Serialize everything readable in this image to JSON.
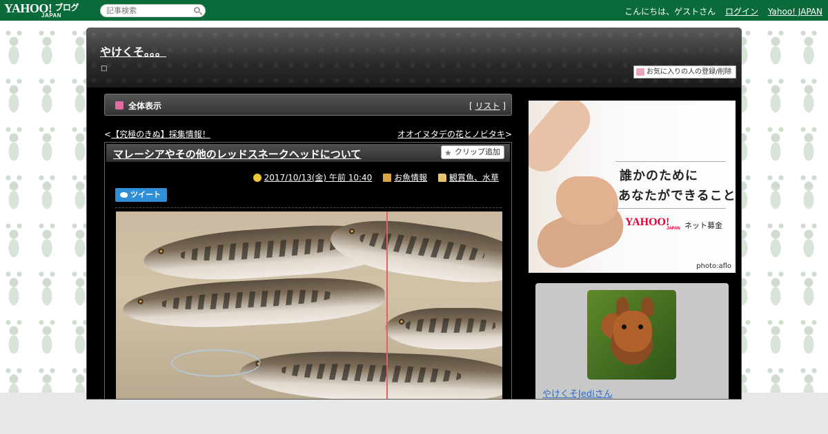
{
  "topbar": {
    "logo_text": "YAHOO!",
    "logo_sub": "JAPAN",
    "logo_blog": "ブログ",
    "search_placeholder": "記事検索",
    "greeting": "こんにちは、ゲストさん",
    "login_label": "ログイン",
    "yahoo_japan_label": "Yahoo! JAPAN"
  },
  "blog": {
    "title": "やけくそ。。。",
    "subtitle": "□",
    "favorite_button": "お気に入りの人の登録/削除"
  },
  "main": {
    "all_view_label": "全体表示",
    "list_bracket_open": "[ ",
    "list_label": "リスト",
    "list_bracket_close": " ]",
    "prev_arrow": "<",
    "prev_link": "【究極のきぬ】採集情報！",
    "next_link": "オオイヌタデの花とノビタキ",
    "next_arrow": ">"
  },
  "article": {
    "title": "マレーシアやその他のレッドスネークヘッドについて",
    "clip_button": "クリップ追加",
    "date": "2017/10/13(金) 午前 10:40",
    "category1": "お魚情報",
    "category2": "観賞魚、水草",
    "tweet_label": "ツイート"
  },
  "sidebar": {
    "ad": {
      "line1": "誰かのために",
      "line2": "あなたができること",
      "brand": "YAHOO!",
      "brand_sub": "JAPAN",
      "service": "ネット募金",
      "credit": "photo:aflo"
    },
    "profile_name": "やけくそJediさん"
  },
  "colors": {
    "topbar_bg": "#0a6a3a",
    "frame_bg": "#000000",
    "link_blue": "#2a6fd0",
    "accent_pink": "#e36ba1",
    "tweet_blue": "#2f8fd9"
  }
}
